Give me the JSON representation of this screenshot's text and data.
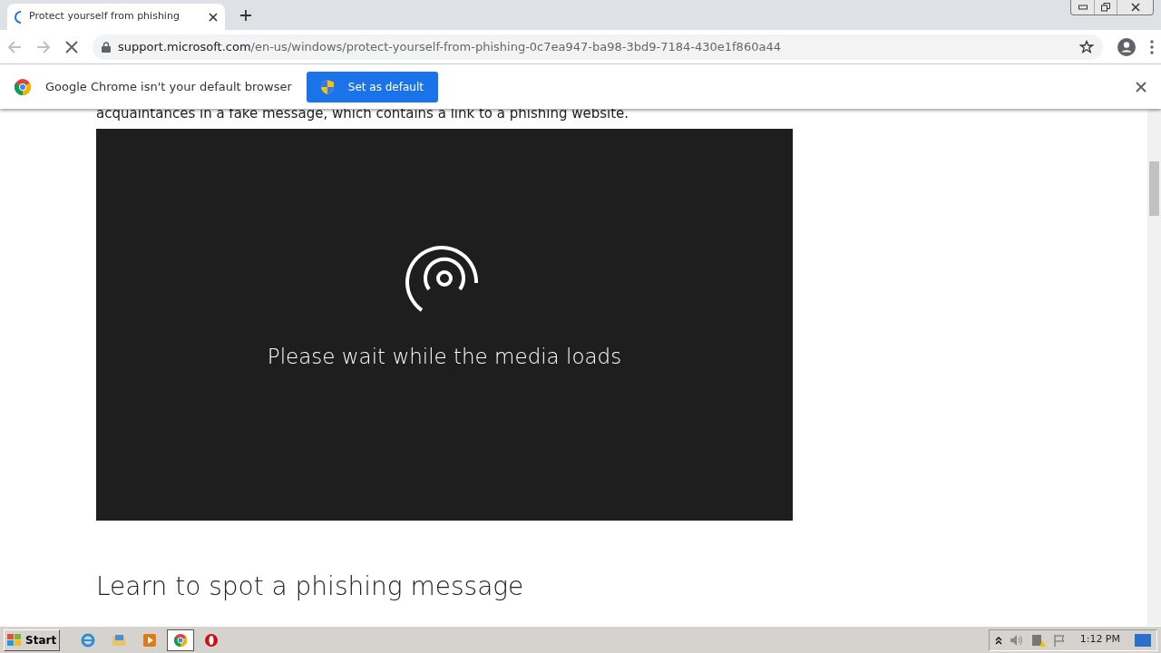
{
  "browser": {
    "tabs": [
      {
        "title": "Protect yourself from phishing",
        "loading": true,
        "selected": true
      }
    ],
    "address_bar": {
      "host": "support.microsoft.com",
      "path": "/en-us/windows/protect-yourself-from-phishing-0c7ea947-ba98-3bd9-7184-430e1f860a44",
      "secure": true
    },
    "back_enabled": false,
    "forward_enabled": false,
    "loading": true
  },
  "infobar": {
    "message": "Google Chrome isn't your default browser",
    "button": "Set as default"
  },
  "page": {
    "intro_text": "acquaintances in a fake message, which contains a link to a phishing website.",
    "media": {
      "message": "Please wait while the media loads"
    },
    "heading": "Learn to spot a phishing message"
  },
  "taskbar": {
    "start": "Start",
    "apps": [
      {
        "kind": "ie",
        "selected": false
      },
      {
        "kind": "explorer",
        "selected": false
      },
      {
        "kind": "media",
        "selected": false
      },
      {
        "kind": "chrome",
        "selected": true
      },
      {
        "kind": "opera",
        "selected": false
      }
    ],
    "clock": "1:12 PM"
  }
}
